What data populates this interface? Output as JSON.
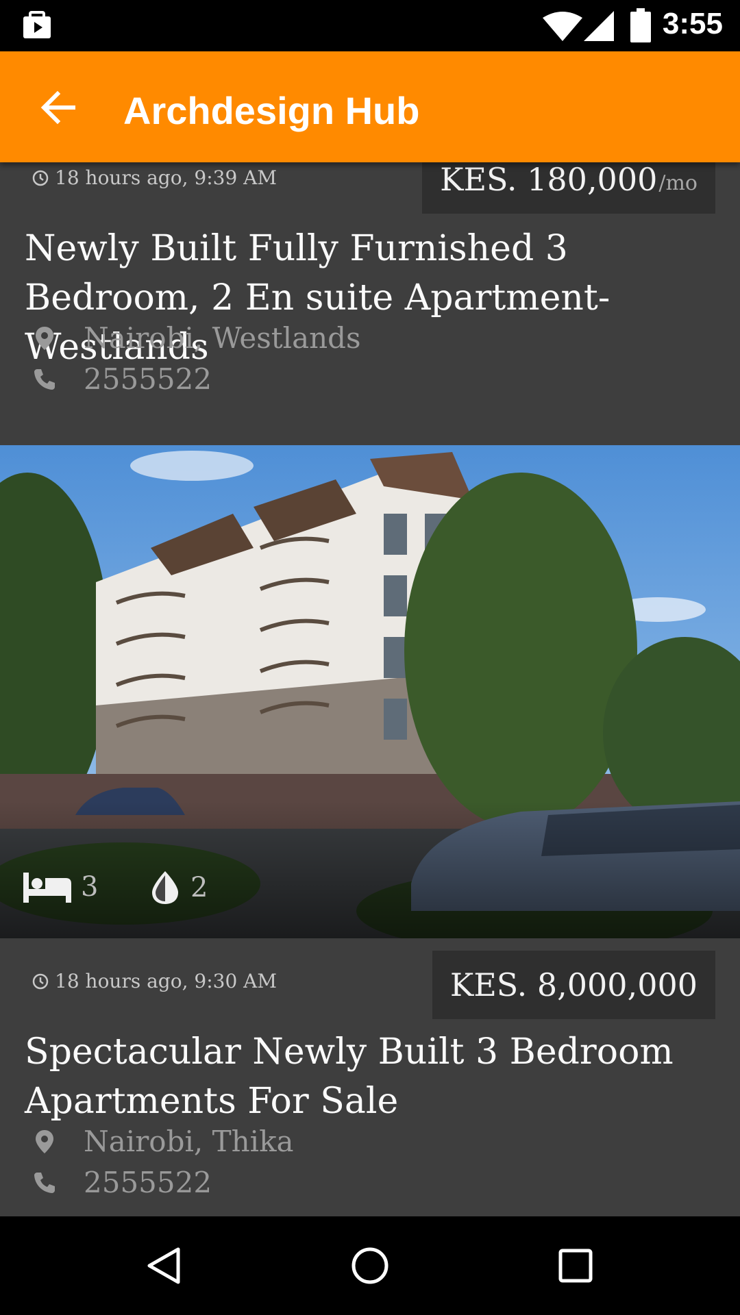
{
  "status_bar": {
    "time": "3:55"
  },
  "app_bar": {
    "title": "Archdesign Hub"
  },
  "listings": [
    {
      "time": "18 hours ago, 9:39 AM",
      "price": "KES. 180,000",
      "price_unit": "/mo",
      "title": "Newly Built Fully Furnished 3 Bedroom, 2 En suite Apartment-Westlands",
      "location": "Nairobi, Westlands",
      "phone": "2555522"
    },
    {
      "bedrooms": "3",
      "bathrooms": "2",
      "time": "18 hours ago, 9:30 AM",
      "price": "KES. 8,000,000",
      "title": "Spectacular Newly Built 3 Bedroom Apartments For Sale",
      "location": "Nairobi, Thika",
      "phone": "2555522"
    }
  ],
  "colors": {
    "accent": "#ff8a00",
    "card_bg": "#3e3e3e",
    "price_bg": "#2f2f2f"
  }
}
